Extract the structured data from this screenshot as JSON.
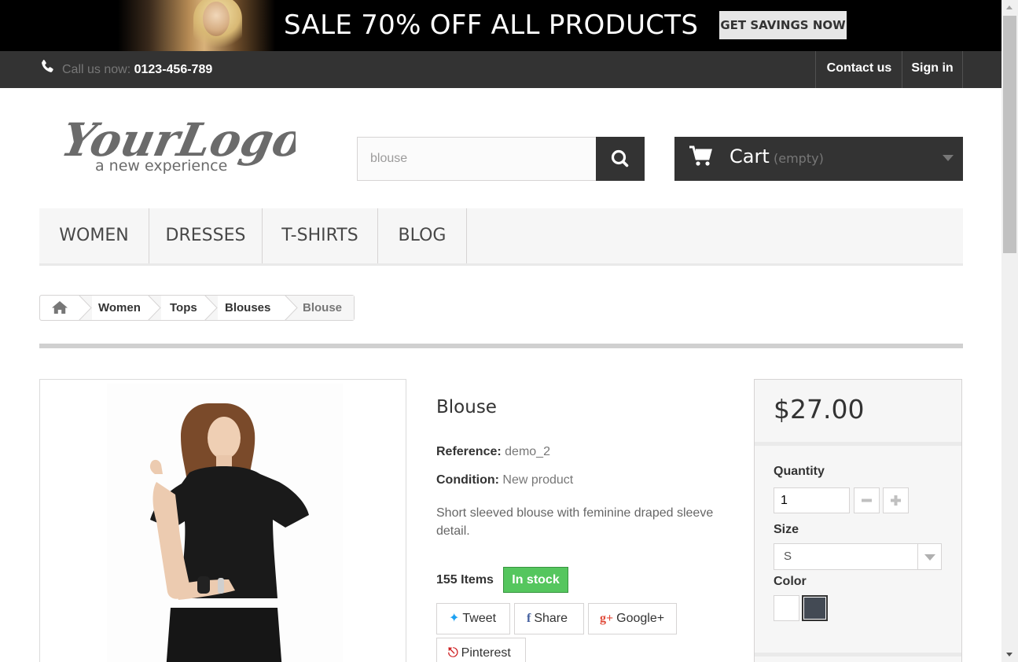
{
  "banner": {
    "sale_text": "SALE 70% OFF ALL PRODUCTS",
    "cta_label": "GET SAVINGS NOW"
  },
  "topnav": {
    "call_label": "Call us now:",
    "phone": "0123-456-789",
    "contact_label": "Contact us",
    "signin_label": "Sign in",
    "icon": "phone-icon"
  },
  "header": {
    "logo_text": "YourLogo",
    "logo_tagline": "a new experience",
    "search_value": "blouse",
    "cart_label": "Cart",
    "cart_status": "(empty)"
  },
  "menu": {
    "items": [
      {
        "label": "WOMEN"
      },
      {
        "label": "DRESSES"
      },
      {
        "label": "T-SHIRTS"
      },
      {
        "label": "BLOG"
      }
    ]
  },
  "breadcrumb": {
    "items": [
      "Women",
      "Tops",
      "Blouses",
      "Blouse"
    ],
    "home_icon": "home-icon"
  },
  "product": {
    "name": "Blouse",
    "reference_label": "Reference:",
    "reference": "demo_2",
    "condition_label": "Condition:",
    "condition": "New product",
    "description": "Short sleeved blouse with feminine draped sleeve detail.",
    "quantity_available": "155 Items",
    "stock_badge": "In stock",
    "share_buttons": {
      "tweet": "Tweet",
      "share": "Share",
      "googleplus": "Google+",
      "pinterest": "Pinterest"
    }
  },
  "buybox": {
    "price": "$27.00",
    "quantity_label": "Quantity",
    "quantity_value": "1",
    "size_label": "Size",
    "size_value": "S",
    "color_label": "Color",
    "colors": [
      "#ffffff",
      "#434a54"
    ]
  },
  "colors": {
    "dark": "#333333",
    "stock_green": "#55c65e",
    "menu_bg": "#f6f6f6"
  }
}
